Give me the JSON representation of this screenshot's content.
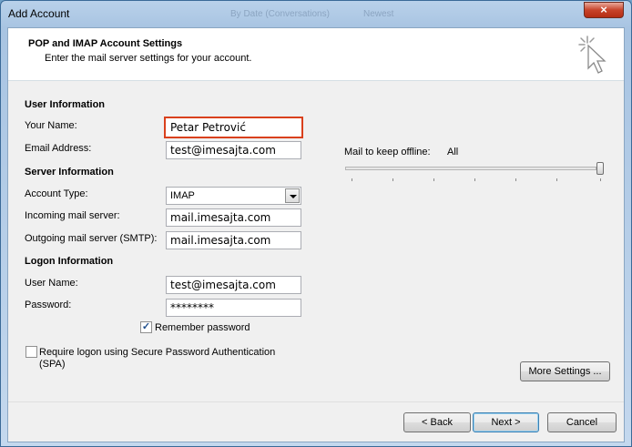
{
  "window": {
    "title": "Add Account",
    "close_glyph": "×",
    "background_ghost": [
      "By Date (Conversations)",
      "Newest"
    ]
  },
  "header": {
    "title": "POP and IMAP Account Settings",
    "subtitle": "Enter the mail server settings for your account.",
    "icon": "wizard-cursor-icon"
  },
  "user_info": {
    "heading": "User Information",
    "name_label": "Your Name:",
    "name_value": "Petar Petrović",
    "email_label": "Email Address:",
    "email_value": "test@imesajta.com"
  },
  "server_info": {
    "heading": "Server Information",
    "account_type_label": "Account Type:",
    "account_type_value": "IMAP",
    "incoming_label": "Incoming mail server:",
    "incoming_value": "mail.imesajta.com",
    "outgoing_label": "Outgoing mail server (SMTP):",
    "outgoing_value": "mail.imesajta.com"
  },
  "logon_info": {
    "heading": "Logon Information",
    "username_label": "User Name:",
    "username_value": "test@imesajta.com",
    "password_label": "Password:",
    "password_value": "********",
    "remember_label": "Remember password",
    "remember_checked": true,
    "spa_label_line1": "Require logon using Secure Password Authentication",
    "spa_label_line2": "(SPA)",
    "spa_checked": false
  },
  "offline": {
    "label": "Mail to keep offline:",
    "value": "All",
    "slider_level": 1.0
  },
  "buttons": {
    "more_settings": "More Settings ...",
    "back": "< Back",
    "next": "Next >",
    "cancel": "Cancel"
  },
  "colors": {
    "highlight_border": "#d9401c",
    "title_bar": "#a8c4e2",
    "close_button": "#c7432a"
  }
}
